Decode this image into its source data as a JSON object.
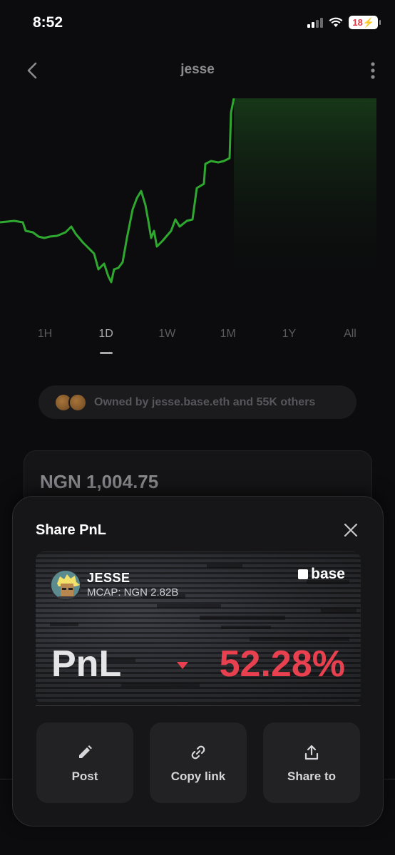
{
  "status_bar": {
    "time": "8:52",
    "battery": "18"
  },
  "nav": {
    "title": "jesse"
  },
  "time_ranges": [
    {
      "label": "1H",
      "active": false
    },
    {
      "label": "1D",
      "active": true
    },
    {
      "label": "1W",
      "active": false
    },
    {
      "label": "1M",
      "active": false
    },
    {
      "label": "1Y",
      "active": false
    },
    {
      "label": "All",
      "active": false
    }
  ],
  "owned_by": {
    "text": "Owned by jesse.base.eth and 55K others"
  },
  "price": {
    "value": "NGN 1,004.75"
  },
  "share_sheet": {
    "title": "Share PnL",
    "card": {
      "token_name": "JESSE",
      "mcap": "MCAP: NGN 2.82B",
      "brand": "base",
      "pnl_label": "PnL",
      "pnl_value": "52.28%",
      "pnl_direction": "down",
      "pnl_color": "#e8404f"
    },
    "actions": [
      {
        "label": "Post",
        "icon": "pencil-icon"
      },
      {
        "label": "Copy link",
        "icon": "link-icon"
      },
      {
        "label": "Share to",
        "icon": "share-icon"
      }
    ]
  },
  "colors": {
    "chart_line": "#2fa82f",
    "accent_negative": "#e8404f",
    "background": "#0c0c0e"
  }
}
